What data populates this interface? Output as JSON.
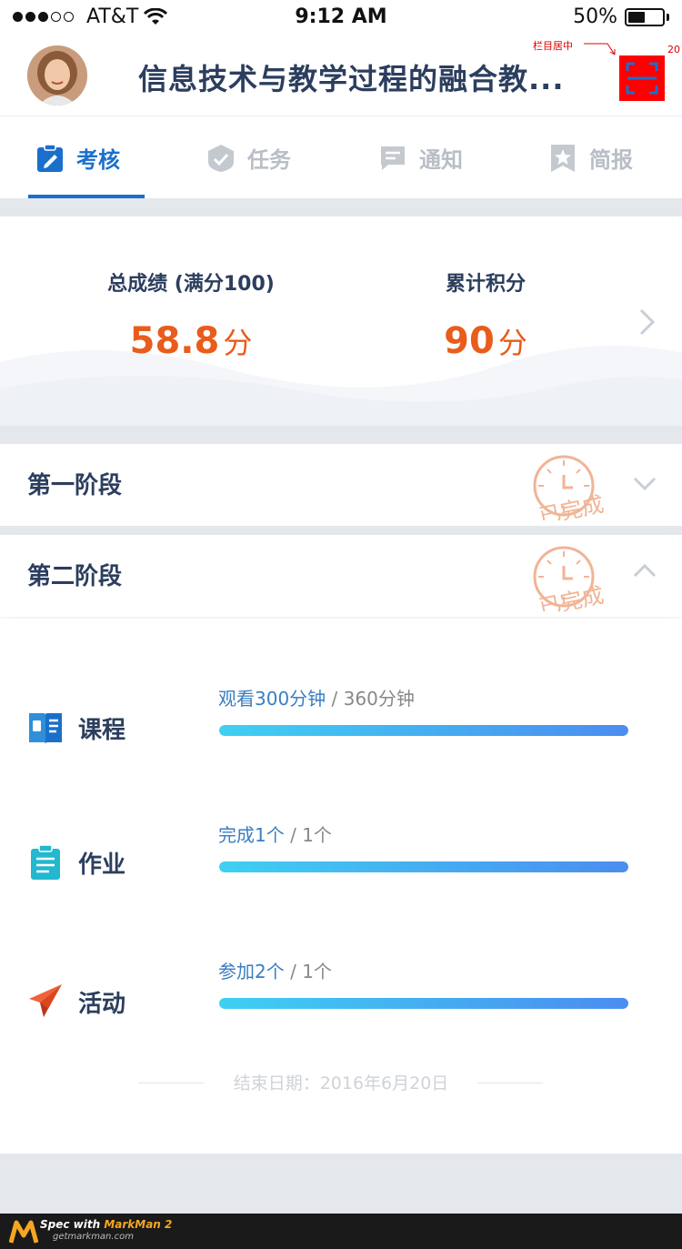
{
  "status_bar": {
    "carrier": "AT&T",
    "time": "9:12 AM",
    "battery": "50%"
  },
  "header": {
    "title": "信息技术与教学过程的融合教...",
    "annotation_center": "栏目居中",
    "annotation_spacing": "20"
  },
  "tabs": [
    {
      "label": "考核",
      "icon": "clipboard-edit-icon",
      "active": true
    },
    {
      "label": "任务",
      "icon": "task-check-icon",
      "active": false
    },
    {
      "label": "通知",
      "icon": "message-icon",
      "active": false
    },
    {
      "label": "简报",
      "icon": "star-bookmark-icon",
      "active": false
    }
  ],
  "score": {
    "total_label": "总成绩 (满分100)",
    "total_value": "58.8",
    "total_unit": "分",
    "points_label": "累计积分",
    "points_value": "90",
    "points_unit": "分"
  },
  "stages": [
    {
      "title": "第一阶段",
      "stamp": "已完成",
      "expanded": false
    },
    {
      "title": "第二阶段",
      "stamp": "已完成",
      "expanded": true
    }
  ],
  "details": [
    {
      "label": "课程",
      "icon": "book-icon",
      "done": "观看300分钟",
      "total": "360分钟",
      "progress": 1.0
    },
    {
      "label": "作业",
      "icon": "homework-clipboard-icon",
      "done": "完成1个",
      "total": "1个",
      "progress": 1.0
    },
    {
      "label": "活动",
      "icon": "paper-plane-icon",
      "done": "参加2个",
      "total": "1个",
      "progress": 1.0
    }
  ],
  "progress_separator": "/",
  "end_date": "结束日期：2016年6月20日",
  "footer": {
    "brand_prefix": "Spec with ",
    "brand_name": "MarkMan 2",
    "url": "getmarkman.com"
  },
  "colors": {
    "accent": "#1b6fcc",
    "score": "#e95c1b",
    "stamp": "#f1b495",
    "progress_start": "#3fd0f2",
    "progress_end": "#4b8df0"
  }
}
